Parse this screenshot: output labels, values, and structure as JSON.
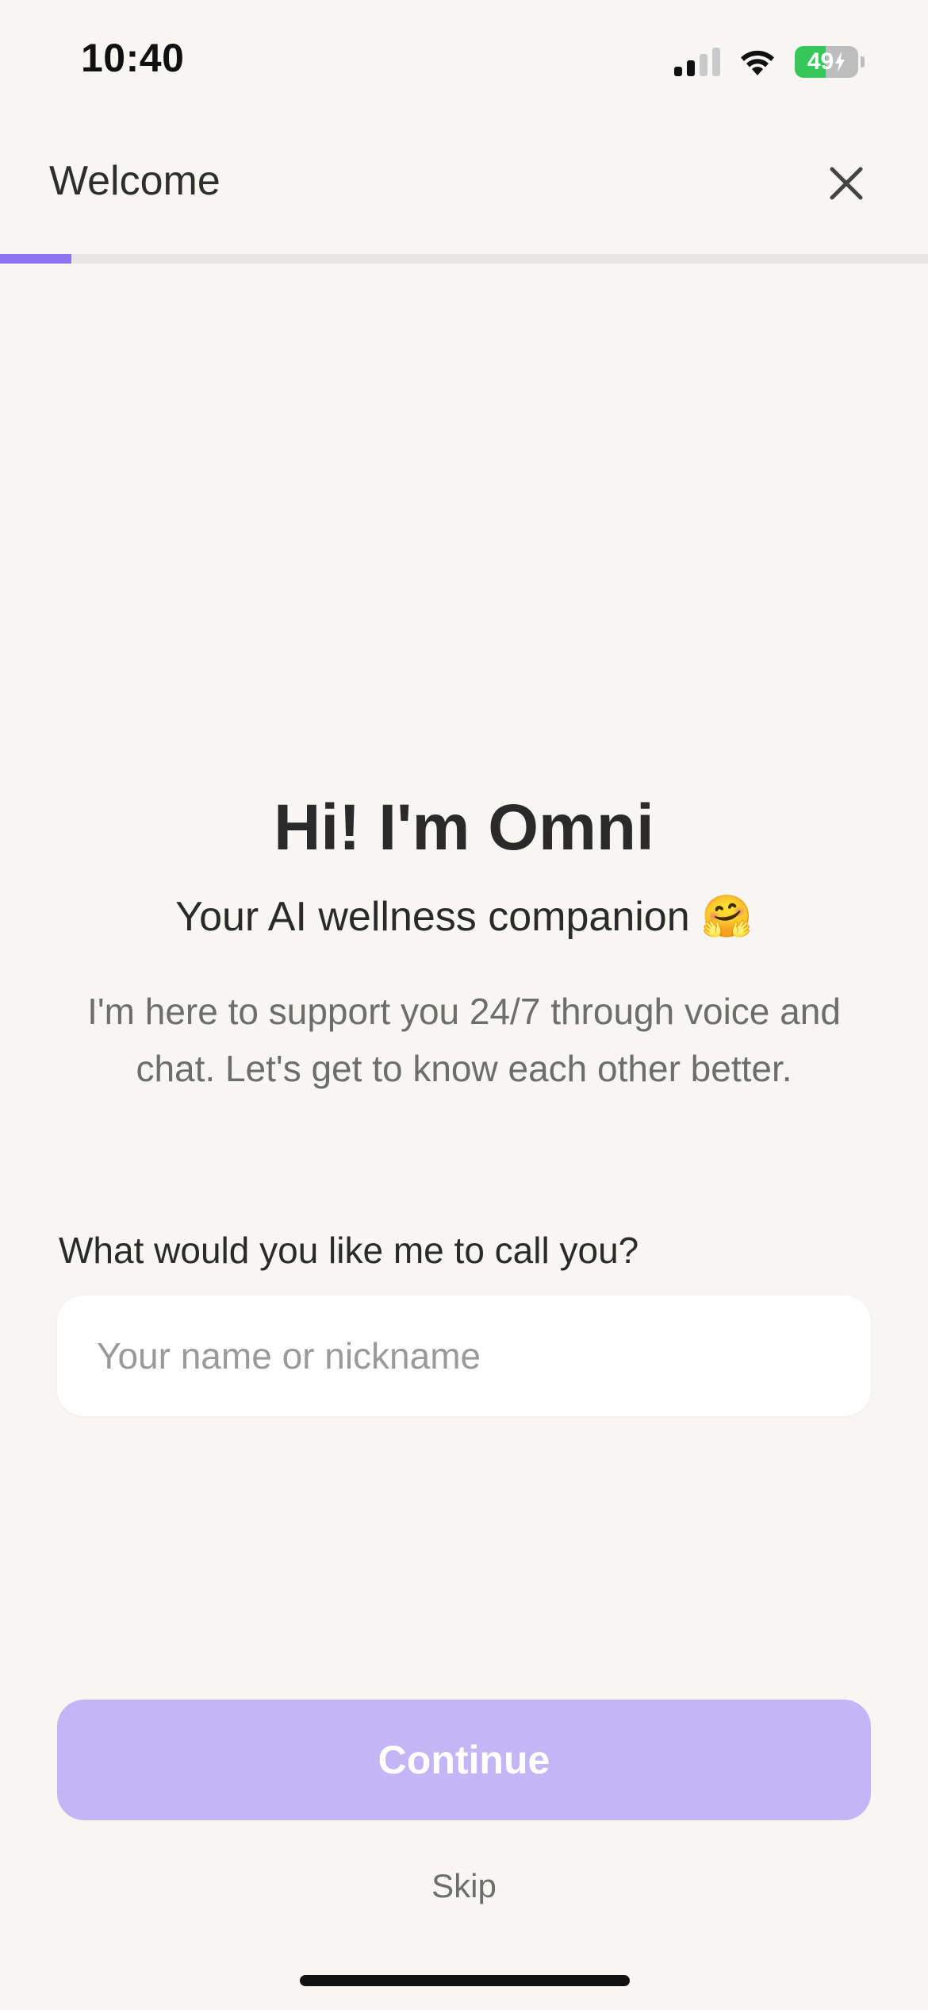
{
  "status_bar": {
    "time": "10:40",
    "battery_level": "49",
    "battery_percent": 49,
    "signal_bars_active": 2,
    "signal_bars_total": 4
  },
  "header": {
    "title": "Welcome",
    "close_icon": "close-icon"
  },
  "progress": {
    "fraction": 0.077,
    "accent_color": "#8b74f0"
  },
  "intro": {
    "title": "Hi! I'm Omni",
    "subtitle": "Your AI wellness companion",
    "subtitle_emoji": "🤗",
    "description": "I'm here to support you 24/7 through voice and chat. Let's get to know each other better."
  },
  "name_field": {
    "label": "What would you like me to call you?",
    "placeholder": "Your name or nickname",
    "value": ""
  },
  "actions": {
    "continue_label": "Continue",
    "continue_color": "#c3b5f6",
    "skip_label": "Skip"
  }
}
